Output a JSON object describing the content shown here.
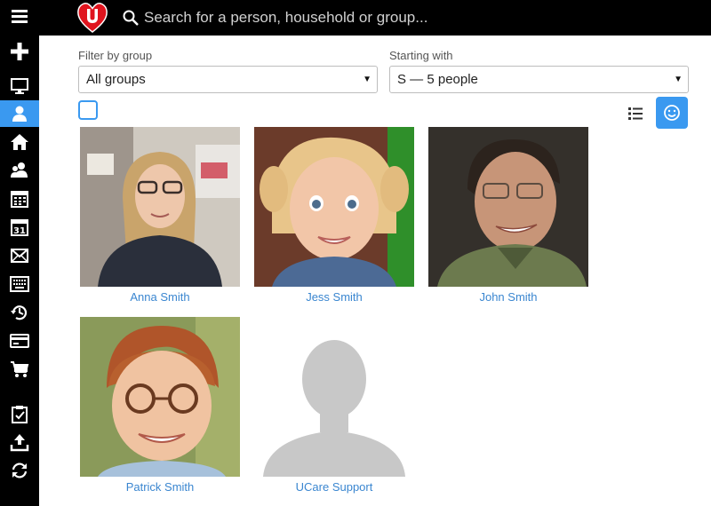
{
  "search": {
    "placeholder": "Search for a person, household or group..."
  },
  "filters": {
    "group_label": "Filter by group",
    "group_value": "All groups",
    "starting_label": "Starting with",
    "starting_value": "S — 5 people"
  },
  "people": [
    {
      "name": "Anna Smith"
    },
    {
      "name": "Jess Smith"
    },
    {
      "name": "John Smith"
    },
    {
      "name": "Patrick Smith"
    },
    {
      "name": "UCare Support"
    }
  ],
  "colors": {
    "accent": "#3a99f0",
    "link": "#3a86d0",
    "logo_red": "#e0141e"
  },
  "rail_icons": [
    "menu-icon",
    "add-icon",
    "monitor-icon",
    "person-icon",
    "home-icon",
    "people-icon",
    "calendar-icon",
    "calendar-day-icon",
    "mail-icon",
    "keyboard-icon",
    "history-icon",
    "credit-card-icon",
    "cart-icon",
    "checklist-icon",
    "upload-icon",
    "sync-icon"
  ]
}
